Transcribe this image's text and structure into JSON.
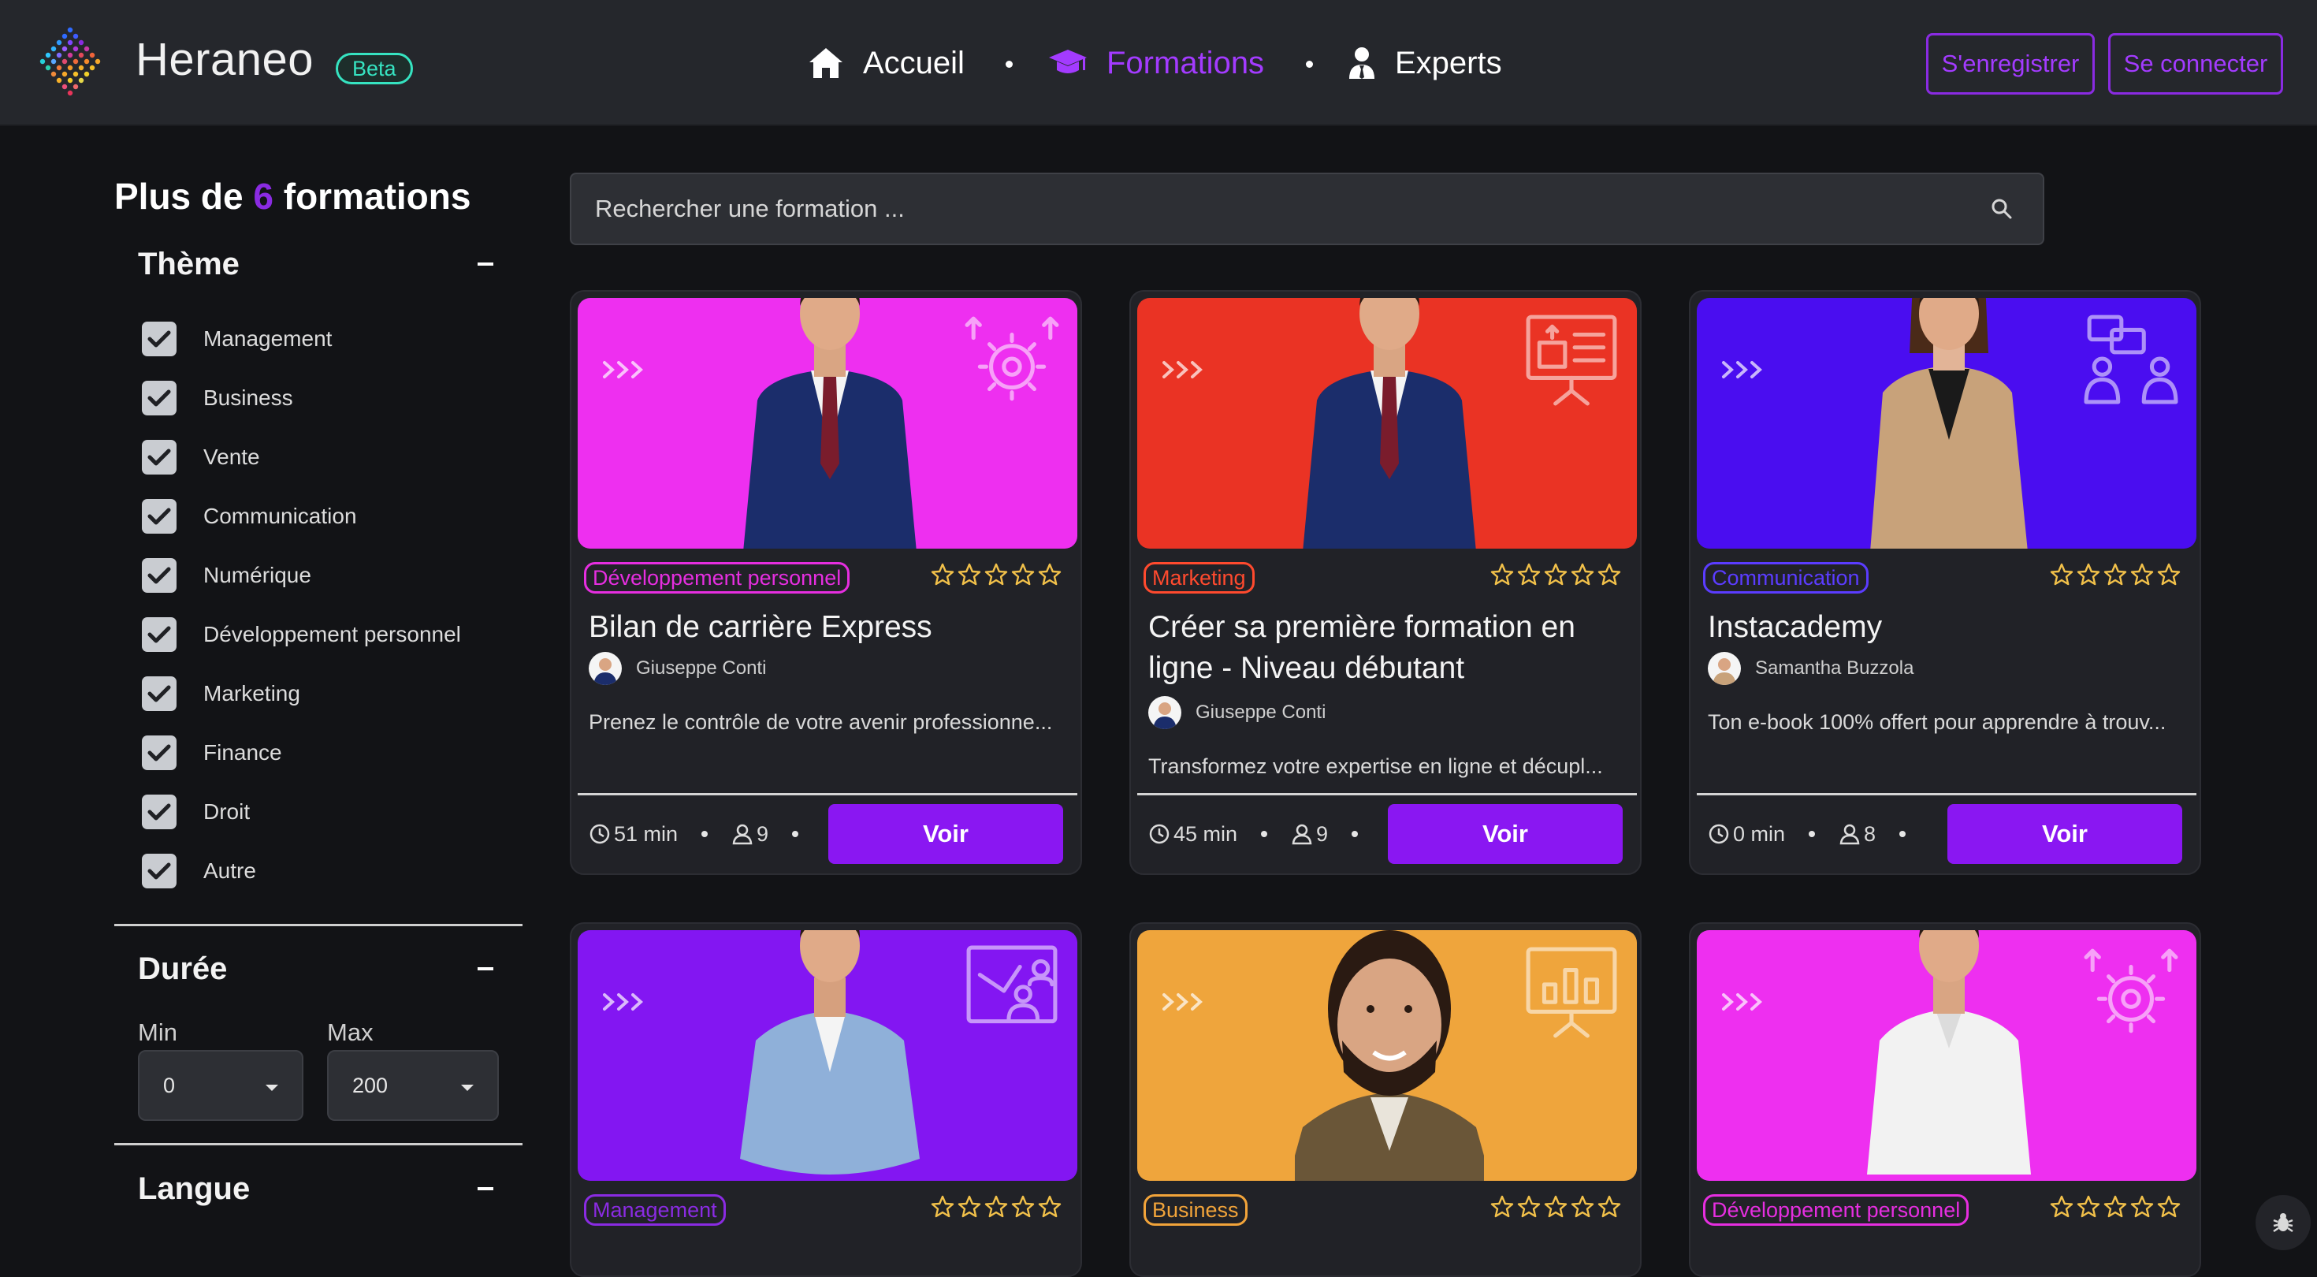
{
  "header": {
    "brand": "Heraneo",
    "badge": "Beta",
    "nav": [
      {
        "label": "Accueil",
        "icon": "home-icon"
      },
      {
        "label": "Formations",
        "icon": "graduation-cap-icon",
        "active": true
      },
      {
        "label": "Experts",
        "icon": "user-tie-icon"
      }
    ],
    "register_label": "S'enregistrer",
    "login_label": "Se connecter"
  },
  "sidebar": {
    "title_prefix": "Plus de",
    "title_count": "6",
    "title_suffix": "formations",
    "theme": {
      "heading": "Thème",
      "options": [
        {
          "label": "Management",
          "checked": true
        },
        {
          "label": "Business",
          "checked": true
        },
        {
          "label": "Vente",
          "checked": true
        },
        {
          "label": "Communication",
          "checked": true
        },
        {
          "label": "Numérique",
          "checked": true
        },
        {
          "label": "Développement personnel",
          "checked": true
        },
        {
          "label": "Marketing",
          "checked": true
        },
        {
          "label": "Finance",
          "checked": true
        },
        {
          "label": "Droit",
          "checked": true
        },
        {
          "label": "Autre",
          "checked": true
        }
      ]
    },
    "duration": {
      "heading": "Durée",
      "min_label": "Min",
      "max_label": "Max",
      "min_value": "0",
      "max_value": "200"
    },
    "language": {
      "heading": "Langue"
    }
  },
  "search": {
    "placeholder": "Rechercher une formation ..."
  },
  "cards": [
    {
      "tag": "Développement personnel",
      "tag_color": "#e62ee0",
      "banner_color": "#ee2ff0",
      "banner_icon": "gear-upload-icon",
      "title": "Bilan de carrière Express",
      "author": "Giuseppe Conti",
      "description": "Prenez le contrôle de votre avenir professionne...",
      "duration": "51 min",
      "learners": "9",
      "rating": 0,
      "action": "Voir"
    },
    {
      "tag": "Marketing",
      "tag_color": "#ff4a2e",
      "banner_color": "#ea3324",
      "banner_icon": "presentation-board-icon",
      "title": "Créer sa première formation en ligne - Niveau débutant",
      "author": "Giuseppe Conti",
      "description": "Transformez votre expertise en ligne et décupl...",
      "duration": "45 min",
      "learners": "9",
      "rating": 0,
      "action": "Voir"
    },
    {
      "tag": "Communication",
      "tag_color": "#5b3cff",
      "banner_color": "#4a0df0",
      "banner_icon": "chat-people-icon",
      "title": "Instacademy",
      "author": "Samantha Buzzola",
      "description": "Ton e-book 100% offert pour apprendre à trouv...",
      "duration": "0 min",
      "learners": "8",
      "rating": 0,
      "action": "Voir"
    },
    {
      "tag": "Management",
      "tag_color": "#8a2be2",
      "banner_color": "#8316f2",
      "banner_icon": "team-board-icon",
      "title": "",
      "author": "",
      "description": "",
      "rating": 0
    },
    {
      "tag": "Business",
      "tag_color": "#f2a43a",
      "banner_color": "#efa53c",
      "banner_icon": "bar-chart-board-icon",
      "title": "",
      "author": "",
      "description": "",
      "rating": 0
    },
    {
      "tag": "Développement personnel",
      "tag_color": "#e62ee0",
      "banner_color": "#ee2ff0",
      "banner_icon": "gear-upload-icon",
      "title": "",
      "author": "",
      "description": "",
      "rating": 0
    }
  ]
}
